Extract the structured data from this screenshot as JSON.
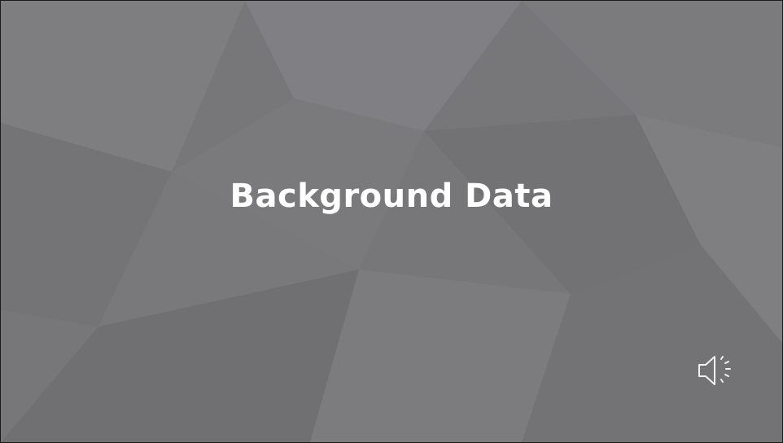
{
  "slide": {
    "title": "Background Data"
  },
  "audio": {
    "icon": "speaker-volume-icon"
  },
  "colors": {
    "background": "#77777a",
    "title_text": "#ffffff",
    "icon_stroke": "#f2f2f2"
  }
}
